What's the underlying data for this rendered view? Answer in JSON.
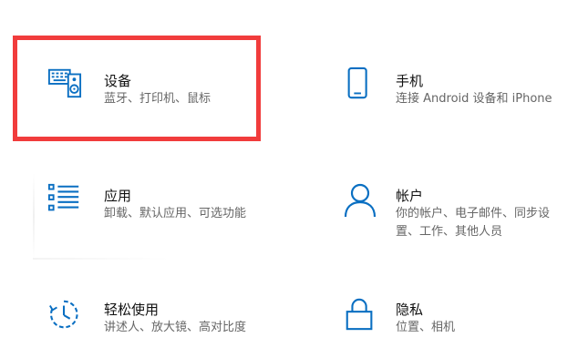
{
  "settings": {
    "tiles": [
      {
        "title": "设备",
        "desc": "蓝牙、打印机、鼠标",
        "icon": "keyboard-speaker-icon"
      },
      {
        "title": "手机",
        "desc": "连接 Android 设备和 iPhone",
        "icon": "phone-icon"
      },
      {
        "title": "应用",
        "desc": "卸载、默认应用、可选功能",
        "icon": "apps-list-icon"
      },
      {
        "title": "帐户",
        "desc": "你的帐户、电子邮件、同步设置、工作、其他人员",
        "icon": "person-icon"
      },
      {
        "title": "轻松使用",
        "desc": "讲述人、放大镜、高对比度",
        "icon": "ease-of-access-timer-icon"
      },
      {
        "title": "隐私",
        "desc": "位置、相机",
        "icon": "lock-icon"
      }
    ]
  },
  "colors": {
    "accent": "#0a6fc2",
    "highlight_border": "#f13c3c",
    "title": "#111111",
    "desc": "#666666"
  }
}
